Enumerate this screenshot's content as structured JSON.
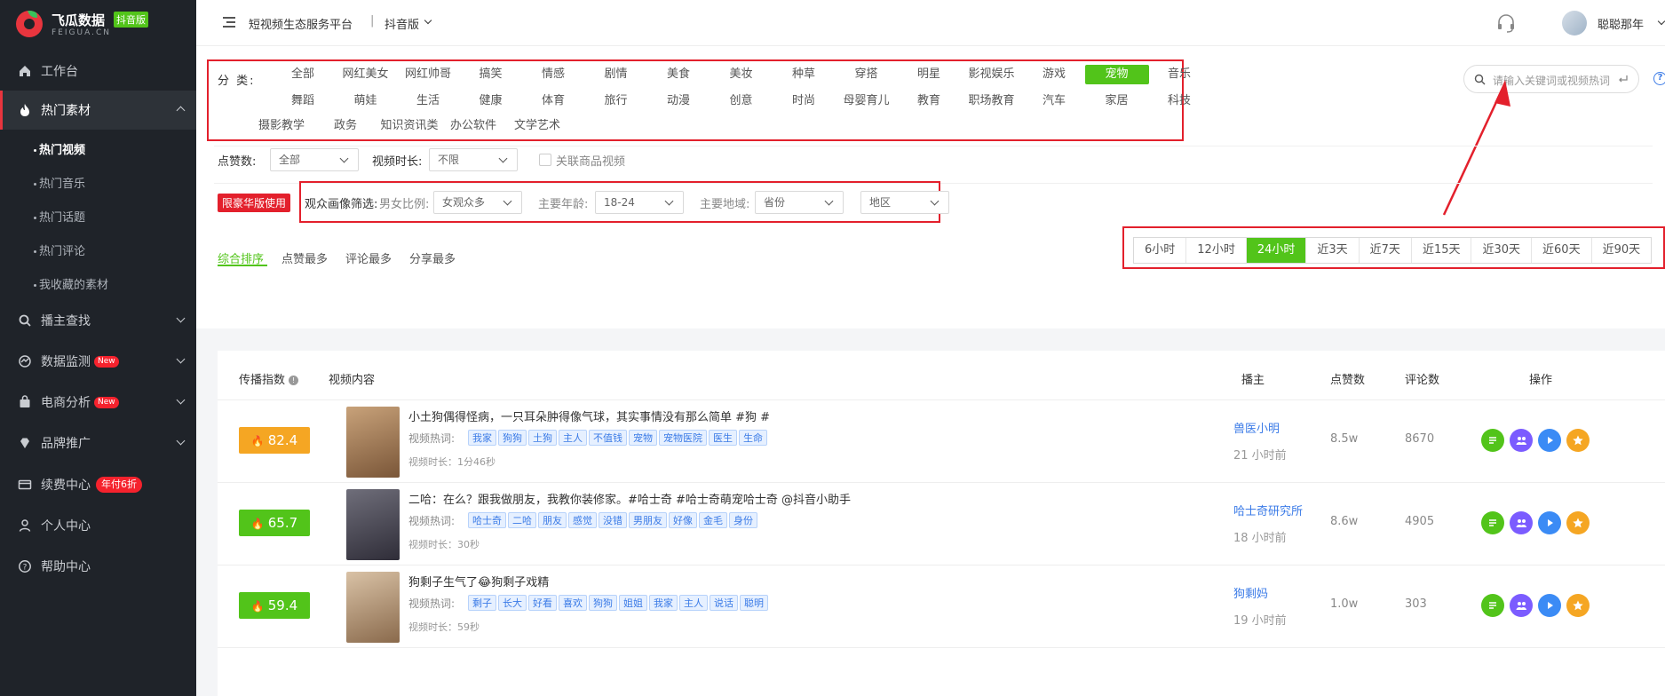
{
  "brand": {
    "name": "飞瓜数据",
    "badge": "抖音版",
    "sub": "FEIGUA.CN"
  },
  "sidebar": {
    "items": [
      {
        "label": "工作台",
        "icon": "home-icon"
      },
      {
        "label": "热门素材",
        "icon": "flame-icon"
      },
      {
        "label": "播主查找",
        "icon": "search-icon"
      },
      {
        "label": "数据监测",
        "icon": "monitor-icon",
        "badge": "New"
      },
      {
        "label": "电商分析",
        "icon": "bag-icon",
        "badge": "New"
      },
      {
        "label": "品牌推广",
        "icon": "diamond-icon"
      },
      {
        "label": "续费中心",
        "icon": "card-icon",
        "badge": "年付6折"
      },
      {
        "label": "个人中心",
        "icon": "user-icon"
      },
      {
        "label": "帮助中心",
        "icon": "help-icon"
      }
    ],
    "sub_items": [
      "热门视频",
      "热门音乐",
      "热门话题",
      "热门评论",
      "我收藏的素材"
    ]
  },
  "topbar": {
    "title": "短视频生态服务平台",
    "separator": "|",
    "version": "抖音版",
    "user": "聪聪那年"
  },
  "filters": {
    "category_label": "分 类:",
    "categories_row1": [
      "全部",
      "网红美女",
      "网红帅哥",
      "搞笑",
      "情感",
      "剧情",
      "美食",
      "美妆",
      "种草",
      "穿搭",
      "明星",
      "影视娱乐",
      "游戏",
      "宠物",
      "音乐"
    ],
    "categories_row2": [
      "舞蹈",
      "萌娃",
      "生活",
      "健康",
      "体育",
      "旅行",
      "动漫",
      "创意",
      "时尚",
      "母婴育儿",
      "教育",
      "职场教育",
      "汽车",
      "家居",
      "科技"
    ],
    "categories_row3": [
      "摄影教学",
      "政务",
      "知识资讯类",
      "办公软件",
      "文学艺术"
    ],
    "active_category": "宠物",
    "search_placeholder": "请输入关键词或视频热词",
    "likes_label": "点赞数:",
    "likes_value": "全部",
    "duration_label": "视频时长:",
    "duration_value": "不限",
    "product_label": "关联商品视频",
    "vip_badge": "限豪华版使用",
    "audience_label": "观众画像筛选:",
    "gender_label": "男女比例:",
    "gender_value": "女观众多",
    "age_label": "主要年龄:",
    "age_value": "18-24",
    "region_label": "主要地域:",
    "province_value": "省份",
    "area_value": "地区",
    "sort_tabs": [
      "综合排序",
      "点赞最多",
      "评论最多",
      "分享最多"
    ],
    "time_ranges": [
      "6小时",
      "12小时",
      "24小时",
      "近3天",
      "近7天",
      "近15天",
      "近30天",
      "近60天",
      "近90天"
    ],
    "active_time": "24小时"
  },
  "table": {
    "headers": {
      "score": "传播指数",
      "content": "视频内容",
      "author": "播主",
      "likes": "点赞数",
      "comments": "评论数",
      "ops": "操作"
    },
    "hot_label": "视频热词:",
    "rows": [
      {
        "score": "82.4",
        "score_color": "#f5a623",
        "title": "小土狗偶得怪病，一只耳朵肿得像气球，其实事情没有那么简单 #狗 #",
        "tags": [
          "我家",
          "狗狗",
          "土狗",
          "主人",
          "不值钱",
          "宠物",
          "宠物医院",
          "医生",
          "生命"
        ],
        "duration": "视频时长：1分46秒",
        "author": "兽医小明",
        "ago": "21 小时前",
        "likes": "8.5w",
        "comments": "8670"
      },
      {
        "score": "65.7",
        "score_color": "#52c41a",
        "title": "二哈：在么？跟我做朋友，我教你装修家。#哈士奇 #哈士奇萌宠哈士奇 @抖音小助手",
        "tags": [
          "哈士奇",
          "二哈",
          "朋友",
          "感觉",
          "没错",
          "男朋友",
          "好像",
          "金毛",
          "身份"
        ],
        "duration": "视频时长：30秒",
        "author": "哈士奇研究所",
        "ago": "18 小时前",
        "likes": "8.6w",
        "comments": "4905"
      },
      {
        "score": "59.4",
        "score_color": "#52c41a",
        "title": "狗剩子生气了😂狗剩子戏精",
        "tags": [
          "剩子",
          "长大",
          "好看",
          "喜欢",
          "狗狗",
          "姐姐",
          "我家",
          "主人",
          "说话",
          "聪明"
        ],
        "duration": "视频时长：59秒",
        "author": "狗剩妈",
        "ago": "19 小时前",
        "likes": "1.0w",
        "comments": "303"
      }
    ]
  },
  "colors": {
    "accent": "#52c41a",
    "highlight": "#e3202c",
    "link": "#3b7be7",
    "op_green": "#52c41a",
    "op_purple": "#7b5cff",
    "op_blue": "#3b8bf5",
    "op_orange": "#f5a623"
  }
}
